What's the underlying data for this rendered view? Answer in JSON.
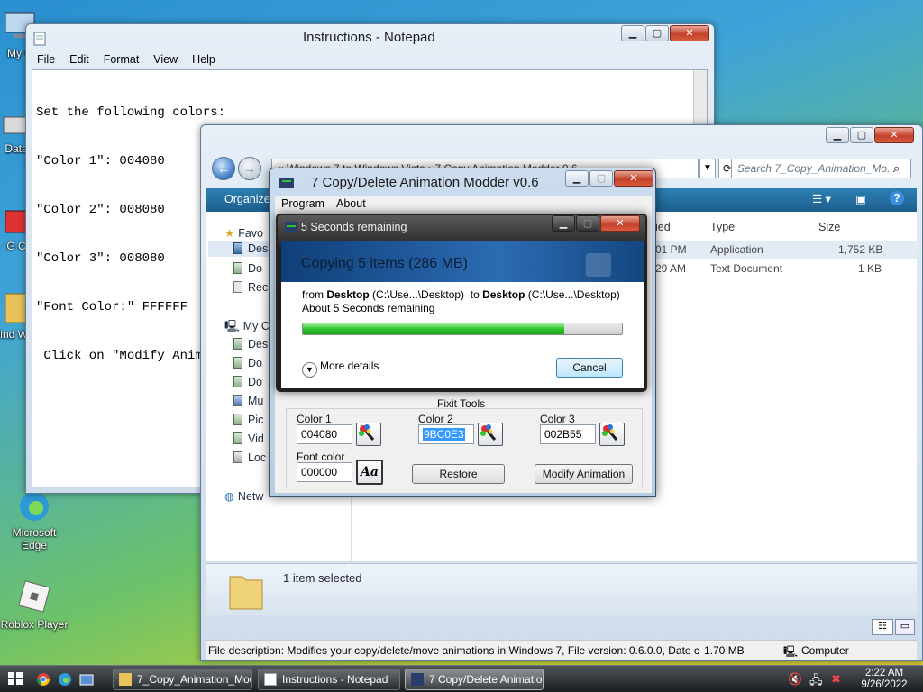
{
  "desktop": {
    "icons": [
      {
        "label": "My C"
      },
      {
        "label": "Data"
      },
      {
        "label": "G C"
      },
      {
        "label": "Wind Wind"
      },
      {
        "label": "Microsoft Edge"
      },
      {
        "label": "Roblox Player"
      }
    ]
  },
  "notepad": {
    "title": "Instructions - Notepad",
    "menu": [
      "File",
      "Edit",
      "Format",
      "View",
      "Help"
    ],
    "lines": [
      "Set the following colors:",
      "\"Color 1\": 004080",
      "\"Color 2\": 008080",
      "\"Color 3\": 008080",
      "\"Font Color:\" FFFFFF",
      " Click on \"Modify Anima"
    ]
  },
  "explorer": {
    "address": "« Windows 7 to Windows Vista  ›  7 Copy Animation Modder 0.6",
    "search_placeholder": "Search 7_Copy_Animation_Mo...",
    "organize": "Organize",
    "tree": [
      "Favo",
      "Des",
      "Do",
      "Rec",
      "My C",
      "Des",
      "Do",
      "Do",
      "Mu",
      "Pic",
      "Vid",
      "Loc",
      "Netw"
    ],
    "columns": {
      "modified": "ied",
      "type": "Type",
      "size": "Size"
    },
    "files": [
      {
        "time": "01 PM",
        "type": "Application",
        "size": "1,752 KB"
      },
      {
        "time": "29 AM",
        "type": "Text Document",
        "size": "1 KB"
      }
    ],
    "details": "1 item selected",
    "status": "File description: Modifies your copy/delete/move animations in Windows 7, File version: 0.6.0.0, Date cr",
    "status_size": "1.70 MB",
    "status_location": "Computer"
  },
  "modder": {
    "title": "7 Copy/Delete Animation Modder v0.6",
    "menu": [
      "Program",
      "About"
    ],
    "group_label": "Fixit Tools",
    "color1_label": "Color 1",
    "color1_value": "004080",
    "color2_label": "Color 2",
    "color2_value": "9BC0E3",
    "color3_label": "Color 3",
    "color3_value": "002B55",
    "font_label": "Font color",
    "font_value": "000000",
    "font_btn": "Aa",
    "restore_btn": "Restore",
    "modify_btn": "Modify Animation"
  },
  "copy_dialog": {
    "title": "5 Seconds remaining",
    "heading": "Copying 5 items (286 MB)",
    "from_word": "from",
    "from_place": "Desktop",
    "from_path": "(C:\\Use...\\Desktop)",
    "to_word": "to",
    "to_place": "Desktop",
    "to_path": "(C:\\Use...\\Desktop)",
    "remaining": "About 5 Seconds remaining",
    "progress": 0.82,
    "more_details": "More details",
    "cancel": "Cancel"
  },
  "taskbar": {
    "items": [
      {
        "label": "7_Copy_Animation_Mod...",
        "active": false
      },
      {
        "label": "Instructions - Notepad",
        "active": false
      },
      {
        "label": "7 Copy/Delete Animatio...",
        "active": true
      }
    ],
    "time": "2:22 AM",
    "date": "9/26/2022"
  },
  "colors": {
    "accent": "#1c5f8f",
    "progress_green": "#2ec42e",
    "selection": "#3399ff"
  }
}
